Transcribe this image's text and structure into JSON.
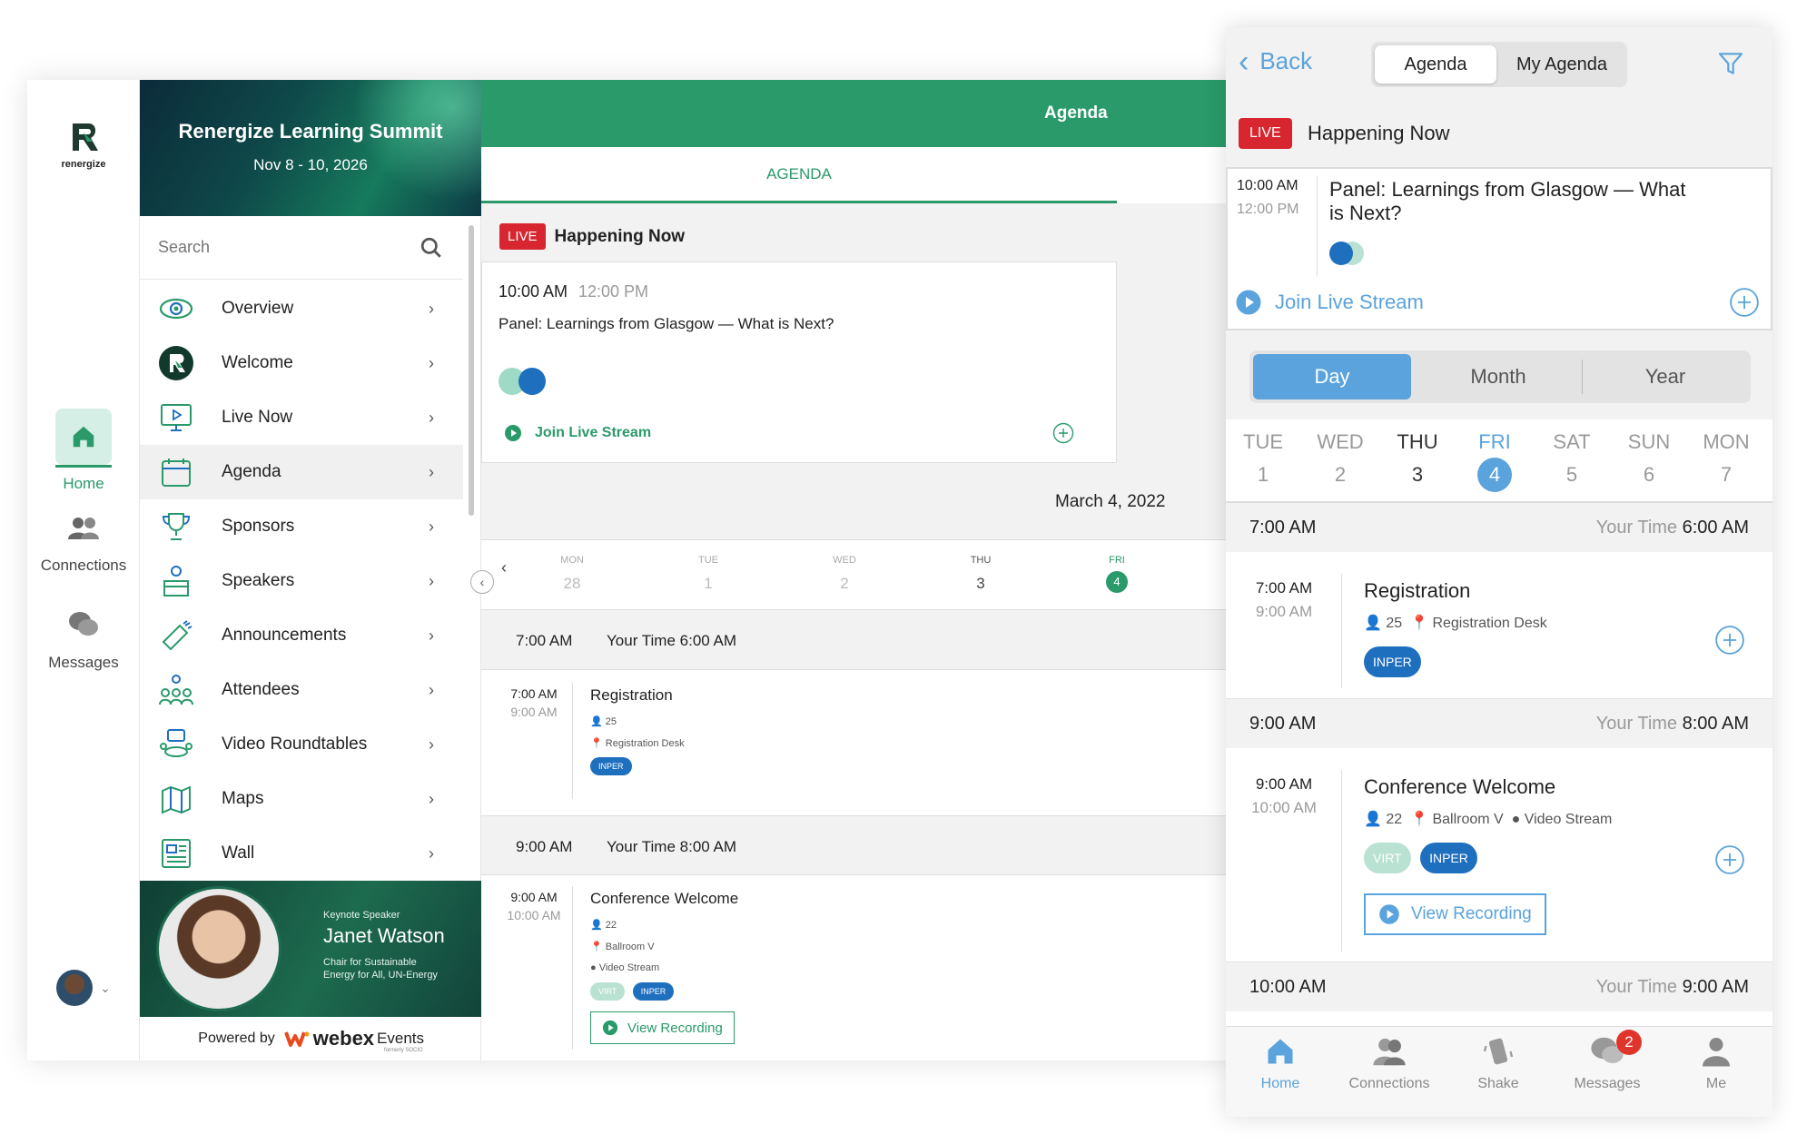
{
  "app": {
    "logo_text": "renergize",
    "event_title": "Renergize Learning Summit",
    "event_dates": "Nov 8 - 10, 2026"
  },
  "rail": [
    {
      "label": "Home",
      "icon": "home-icon",
      "active": true
    },
    {
      "label": "Connections",
      "icon": "people-icon"
    },
    {
      "label": "Messages",
      "icon": "chat-icon"
    }
  ],
  "nav": {
    "search_placeholder": "Search",
    "items": [
      {
        "label": "Overview",
        "icon": "eye-icon"
      },
      {
        "label": "Welcome",
        "icon": "renergize-logo-icon"
      },
      {
        "label": "Live Now",
        "icon": "monitor-play-icon"
      },
      {
        "label": "Agenda",
        "icon": "calendar-icon",
        "active": true
      },
      {
        "label": "Sponsors",
        "icon": "trophy-icon"
      },
      {
        "label": "Speakers",
        "icon": "speaker-podium-icon"
      },
      {
        "label": "Announcements",
        "icon": "megaphone-icon"
      },
      {
        "label": "Attendees",
        "icon": "attendees-icon"
      },
      {
        "label": "Video Roundtables",
        "icon": "roundtable-icon"
      },
      {
        "label": "Maps",
        "icon": "map-icon"
      },
      {
        "label": "Wall",
        "icon": "wall-icon"
      }
    ]
  },
  "keynote": {
    "kicker": "Keynote Speaker",
    "name": "Janet Watson",
    "role_line1": "Chair for Sustainable",
    "role_line2": "Energy for All, UN-Energy"
  },
  "powered": {
    "prefix": "Powered by",
    "brand": "webex",
    "brand_suffix": "Events",
    "formerly": "formerly SOCIO"
  },
  "desktop_main": {
    "header_title": "Agenda",
    "tab_label": "AGENDA",
    "live_badge": "LIVE",
    "happening_now": "Happening Now",
    "live_session": {
      "start": "10:00 AM",
      "end": "12:00 PM",
      "title": "Panel: Learnings from Glasgow — What is Next?",
      "join": "Join Live Stream"
    },
    "date_heading": "March 4, 2022",
    "week": [
      {
        "dow": "MON",
        "num": "28"
      },
      {
        "dow": "TUE",
        "num": "1"
      },
      {
        "dow": "WED",
        "num": "2"
      },
      {
        "dow": "THU",
        "num": "3"
      },
      {
        "dow": "FRI",
        "num": "4",
        "selected": true
      }
    ],
    "slots": [
      {
        "time": "7:00 AM",
        "your_time_label": "Your Time",
        "your_time": "6:00 AM",
        "session": {
          "start": "7:00 AM",
          "end": "9:00 AM",
          "title": "Registration",
          "count": "25",
          "location": "Registration Desk",
          "tags": [
            "INPER"
          ]
        }
      },
      {
        "time": "9:00 AM",
        "your_time_label": "Your Time",
        "your_time": "8:00 AM",
        "session": {
          "start": "9:00 AM",
          "end": "10:00 AM",
          "title": "Conference Welcome",
          "count": "22",
          "location": "Ballroom V",
          "stream": "Video Stream",
          "tags": [
            "VIRT",
            "INPER"
          ],
          "recording": "View Recording"
        }
      }
    ]
  },
  "mobile": {
    "back": "Back",
    "seg_agenda": "Agenda",
    "seg_my_agenda": "My Agenda",
    "live_badge": "LIVE",
    "happening_now": "Happening Now",
    "live_session": {
      "start": "10:00 AM",
      "end": "12:00 PM",
      "title_line1": "Panel: Learnings from Glasgow — What",
      "title_line2": "is Next?",
      "join": "Join Live Stream"
    },
    "range": [
      "Day",
      "Month",
      "Year"
    ],
    "week": [
      {
        "dow": "TUE",
        "num": "1"
      },
      {
        "dow": "WED",
        "num": "2"
      },
      {
        "dow": "THU",
        "num": "3"
      },
      {
        "dow": "FRI",
        "num": "4",
        "selected": true
      },
      {
        "dow": "SAT",
        "num": "5"
      },
      {
        "dow": "SUN",
        "num": "6"
      },
      {
        "dow": "MON",
        "num": "7"
      }
    ],
    "slots": [
      {
        "time": "7:00 AM",
        "your_time_label": "Your Time",
        "your_time": "6:00 AM",
        "session": {
          "start": "7:00 AM",
          "end": "9:00 AM",
          "title": "Registration",
          "count": "25",
          "location": "Registration Desk",
          "tags": [
            "INPER"
          ]
        }
      },
      {
        "time": "9:00 AM",
        "your_time_label": "Your Time",
        "your_time": "8:00 AM",
        "session": {
          "start": "9:00 AM",
          "end": "10:00 AM",
          "title": "Conference Welcome",
          "count": "22",
          "location": "Ballroom V",
          "stream": "Video Stream",
          "tags": [
            "VIRT",
            "INPER"
          ],
          "recording": "View Recording"
        }
      },
      {
        "time": "10:00 AM",
        "your_time_label": "Your Time",
        "your_time": "9:00 AM"
      }
    ],
    "tabbar": [
      {
        "label": "Home",
        "icon": "home-icon",
        "active": true
      },
      {
        "label": "Connections",
        "icon": "people-icon"
      },
      {
        "label": "Shake",
        "icon": "shake-phone-icon"
      },
      {
        "label": "Messages",
        "icon": "chat-icon",
        "badge": "2"
      },
      {
        "label": "Me",
        "icon": "person-icon"
      }
    ]
  },
  "colors": {
    "brand_green": "#2a9a6a",
    "live_red": "#d7262f",
    "accent_blue": "#1f6fbf",
    "mobile_blue": "#5aa3dc"
  }
}
